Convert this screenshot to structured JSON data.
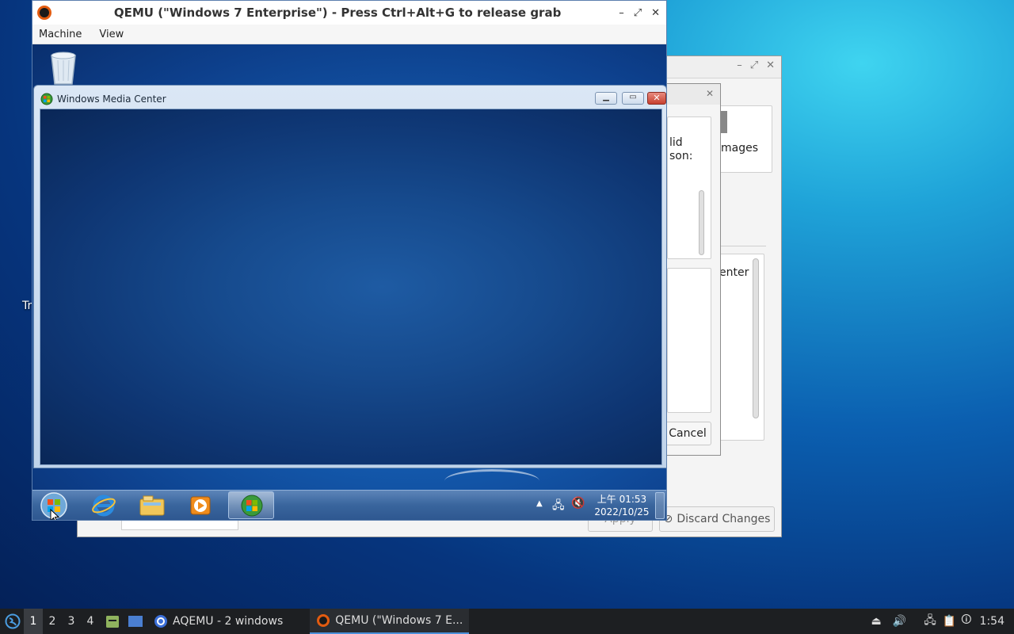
{
  "host_desktop": {
    "partial_label": "Tr"
  },
  "aqemu_main": {
    "partial_images": "mages",
    "partial_center": "enter",
    "apply_label": "Apply",
    "discard_label": "Discard Changes"
  },
  "aqemu_dialog": {
    "partial_text_1": "lid",
    "partial_text_2": "son:",
    "cancel_label": "Cancel"
  },
  "qemu": {
    "title": "QEMU (\"Windows 7 Enterprise\") - Press Ctrl+Alt+G to release grab",
    "menu": [
      "Machine",
      "View"
    ]
  },
  "guest": {
    "wmc_title": "Windows Media Center",
    "clock_time": "上午 01:53",
    "clock_date": "2022/10/25"
  },
  "host_taskbar": {
    "workspaces": [
      "1",
      "2",
      "3",
      "4"
    ],
    "tasks": [
      "AQEMU - 2 windows",
      "QEMU (\"Windows 7 E..."
    ],
    "clock": "1:54"
  },
  "colors": {
    "accent": "#4a90d9"
  }
}
